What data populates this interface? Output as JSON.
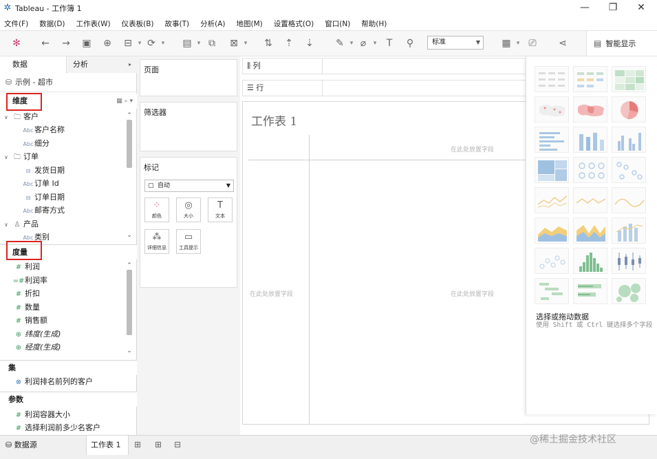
{
  "window": {
    "title": "Tableau - 工作簿 1",
    "controls": [
      "—",
      "❐",
      "✕"
    ]
  },
  "menu": [
    "文件(F)",
    "数据(D)",
    "工作表(W)",
    "仪表板(B)",
    "故事(T)",
    "分析(A)",
    "地图(M)",
    "设置格式(O)",
    "窗口(N)",
    "帮助(H)"
  ],
  "toolbar": {
    "view_select": "标准",
    "smart_show": "智能显示"
  },
  "left_panel": {
    "tabs": [
      "数据",
      "分析"
    ],
    "datasource": "示例 - 超市",
    "dimensions_label": "维度",
    "dimensions": [
      {
        "name": "客户",
        "type": "folder"
      },
      {
        "name": "客户名称",
        "type": "Abc"
      },
      {
        "name": "细分",
        "type": "Abc"
      },
      {
        "name": "订单",
        "type": "folder"
      },
      {
        "name": "发货日期",
        "type": "date"
      },
      {
        "name": "订单 Id",
        "type": "Abc"
      },
      {
        "name": "订单日期",
        "type": "date"
      },
      {
        "name": "邮寄方式",
        "type": "Abc"
      },
      {
        "name": "产品",
        "type": "hierarchy"
      },
      {
        "name": "类别",
        "type": "Abc"
      }
    ],
    "measures_label": "度量",
    "measures": [
      {
        "name": "利润",
        "type": "#"
      },
      {
        "name": "利润率",
        "type": "#"
      },
      {
        "name": "折扣",
        "type": "#"
      },
      {
        "name": "数量",
        "type": "#"
      },
      {
        "name": "销售额",
        "type": "#"
      },
      {
        "name": "纬度(生成)",
        "type": "geo"
      },
      {
        "name": "经度(生成)",
        "type": "geo"
      }
    ],
    "sets_label": "集",
    "sets": [
      "利润排名前列的客户"
    ],
    "params_label": "参数",
    "params": [
      "利润容器大小",
      "选择利润前多少名客户"
    ]
  },
  "shelves": {
    "pages": "页面",
    "filters": "筛选器",
    "marks": "标记",
    "marks_type": "自动",
    "mark_buttons": [
      "颜色",
      "大小",
      "文本",
      "详细信息",
      "工具提示"
    ],
    "columns": "列",
    "rows": "行"
  },
  "canvas": {
    "sheet_title": "工作表 1",
    "drop_hint": "在此处放置字段"
  },
  "smart_show": {
    "hint_title": "选择或拖动数据",
    "hint_desc": "使用 Shift 或 Ctrl 键选择多个字段"
  },
  "bottom": {
    "datasource_tab": "数据源",
    "sheet_tab": "工作表 1"
  },
  "watermark": "@稀土掘金技术社区"
}
